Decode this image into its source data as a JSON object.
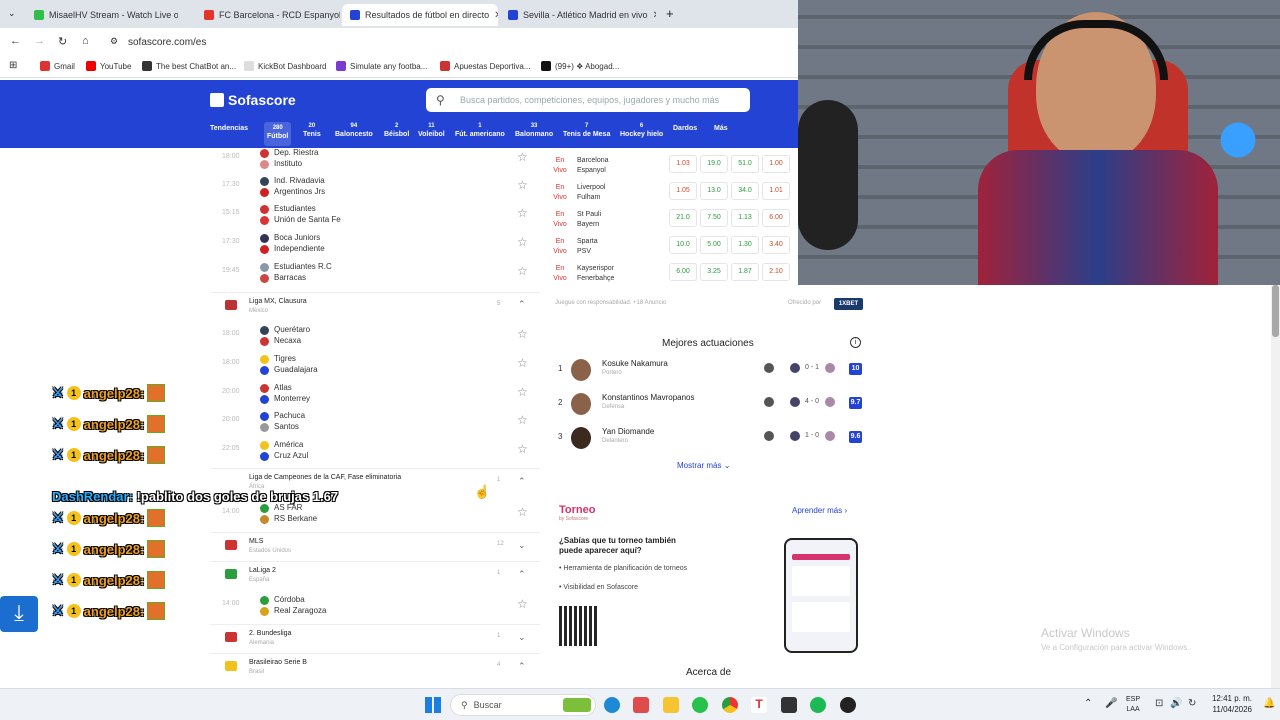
{
  "browser": {
    "tabs": [
      {
        "title": "MisaelHV Stream - Watch Live o",
        "color": "#2fbf4a"
      },
      {
        "title": "FC Barcelona - RCD Espanyol C",
        "color": "#e4332a"
      },
      {
        "title": "Resultados de fútbol en directo",
        "color": "#2343d5"
      },
      {
        "title": "Sevilla - Atlético Madrid en vivo",
        "color": "#2343d5"
      }
    ],
    "url": "sofascore.com/es",
    "bookmarks": [
      {
        "label": "Gmail",
        "color": "#d33"
      },
      {
        "label": "YouTube",
        "color": "#e00"
      },
      {
        "label": "The best ChatBot an...",
        "color": "#333"
      },
      {
        "label": "KickBot Dashboard",
        "color": "#eee"
      },
      {
        "label": "Simulate any footba...",
        "color": "#7a3bd1"
      },
      {
        "label": "Apuestas Deportiva...",
        "color": "#c33"
      },
      {
        "label": "(99+) ❖ Abogad...",
        "color": "#111"
      }
    ]
  },
  "sofascore": {
    "logo": "Sofascore",
    "search_placeholder": "Busca partidos, competiciones, equipos, jugadores y mucho más",
    "nav": [
      {
        "label": "Tendencias",
        "count": ""
      },
      {
        "label": "Fútbol",
        "count": "280"
      },
      {
        "label": "Tenis",
        "count": "20"
      },
      {
        "label": "Baloncesto",
        "count": "94"
      },
      {
        "label": "Béisbol",
        "count": "2"
      },
      {
        "label": "Voleibol",
        "count": "11"
      },
      {
        "label": "Fút. americano",
        "count": "1"
      },
      {
        "label": "Balonmano",
        "count": "33"
      },
      {
        "label": "Tenis de Mesa",
        "count": "7"
      },
      {
        "label": "Hockey hielo",
        "count": "6"
      },
      {
        "label": "Dardos",
        "count": ""
      },
      {
        "label": "Más",
        "count": ""
      }
    ]
  },
  "matches": [
    {
      "time": "18:00",
      "home": "Dep. Riestra",
      "away": "Instituto"
    },
    {
      "time": "17:30",
      "home": "Ind. Rivadavia",
      "away": "Argentinos Jrs"
    },
    {
      "time": "15:15",
      "home": "Estudiantes",
      "away": "Unión de Santa Fe"
    },
    {
      "time": "17:30",
      "home": "Boca Juniors",
      "away": "Independiente"
    },
    {
      "time": "19:45",
      "home": "Estudiantes R.C",
      "away": "Barracas"
    }
  ],
  "ligamx": {
    "name": "Liga MX, Clausura",
    "country": "México",
    "count": "5",
    "matches": [
      {
        "time": "18:00",
        "home": "Querétaro",
        "away": "Necaxa"
      },
      {
        "time": "18:00",
        "home": "Tigres",
        "away": "Guadalajara"
      },
      {
        "time": "20:00",
        "home": "Atlas",
        "away": "Monterrey"
      },
      {
        "time": "20:00",
        "home": "Pachuca",
        "away": "Santos"
      },
      {
        "time": "22:05",
        "home": "América",
        "away": "Cruz Azul"
      }
    ]
  },
  "caf": {
    "name": "Liga de Campeones de la CAF, Fase eliminatoria",
    "country": "África",
    "count": "1",
    "match": {
      "time": "14:00",
      "home": "AS FAR",
      "away": "RS Berkane"
    }
  },
  "mls": {
    "name": "MLS",
    "country": "Estados Unidos",
    "count": "12"
  },
  "laliga2": {
    "name": "LaLiga 2",
    "country": "España",
    "count": "1",
    "match": {
      "time": "14:00",
      "home": "Córdoba",
      "away": "Real Zaragoza"
    }
  },
  "bundesliga2": {
    "name": "2. Bundesliga",
    "country": "Alemania",
    "count": "1"
  },
  "brasileirao": {
    "name": "Brasileirao Serie B",
    "country": "Brasil",
    "count": "4"
  },
  "odds": {
    "live_label_1": "En",
    "live_label_2": "Vivo",
    "rows": [
      {
        "home": "Barcelona",
        "away": "Espanyol",
        "o1": "1.03",
        "ox": "19.0",
        "o2": "51.0",
        "o4": "1.00"
      },
      {
        "home": "Liverpool",
        "away": "Fulham",
        "o1": "1.05",
        "ox": "13.0",
        "o2": "34.0",
        "o4": "1.01"
      },
      {
        "home": "St Pauli",
        "away": "Bayern",
        "o1": "21.0",
        "ox": "7.50",
        "o2": "1.13",
        "o4": "6.00"
      },
      {
        "home": "Sparta",
        "away": "PSV",
        "o1": "10.0",
        "ox": "5.00",
        "o2": "1.30",
        "o4": "3.40"
      },
      {
        "home": "Kayserispor",
        "away": "Fenerbahçe",
        "o1": "6.00",
        "ox": "3.25",
        "o2": "1.87",
        "o4": "2.10"
      }
    ],
    "disclaimer": "Juegue con responsabilidad. +18 Anuncio",
    "offered_by": "Ofrecido por",
    "sponsor": "1XBET"
  },
  "best": {
    "title": "Mejores actuaciones",
    "players": [
      {
        "rank": "1",
        "name": "Kosuke Nakamura",
        "position": "Portero",
        "score": "0 - 1",
        "rating": "10"
      },
      {
        "rank": "2",
        "name": "Konstantinos Mavropanos",
        "position": "Defensa",
        "score": "4 - 0",
        "rating": "9.7"
      },
      {
        "rank": "3",
        "name": "Yan Diomande",
        "position": "Delantero",
        "score": "1 - 0",
        "rating": "9.6"
      }
    ],
    "more": "Mostrar más"
  },
  "torneo": {
    "logo": "Torneo",
    "logo_sub": "by Sofascore",
    "learn": "Aprender más",
    "title": "¿Sabías que tu torneo también puede aparecer aquí?",
    "bullets": [
      "Herramienta de planificación de torneos",
      "Visibilidad en Sofascore"
    ]
  },
  "about": "Acerca de",
  "chat": {
    "repeat_user": "angelp28:",
    "dash_user": "DashRendar:",
    "dash_msg": "!pablito dos goles de brujas 1.67"
  },
  "windows": {
    "activate": "Activar Windows",
    "activate_sub": "Ve a Configuración para activar Windows.",
    "search": "Buscar",
    "lang1": "ESP",
    "lang2": "LAA",
    "time": "12:41 p. m.",
    "date": "11/04/2026"
  }
}
